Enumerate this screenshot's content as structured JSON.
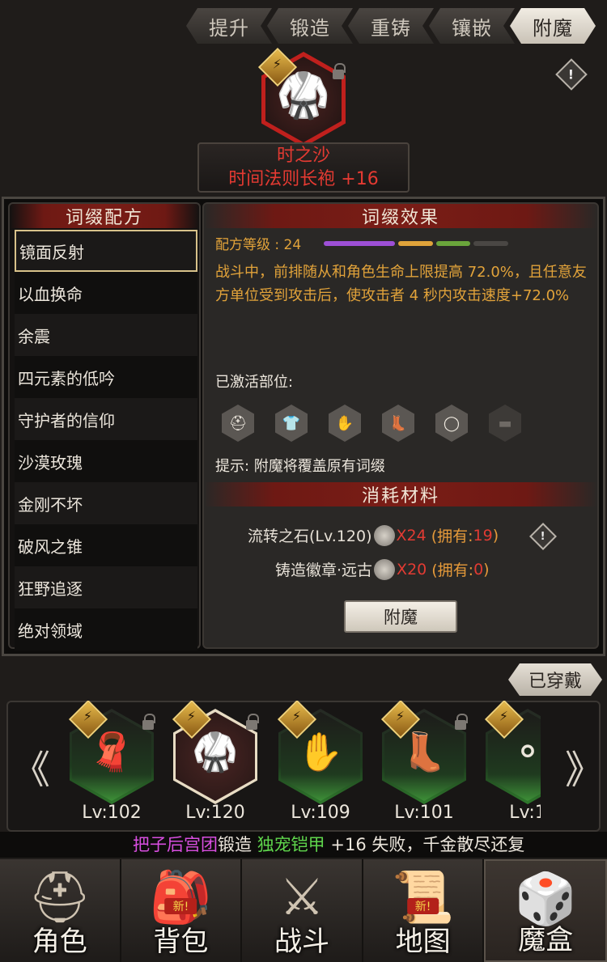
{
  "tabs": [
    {
      "label": "提升"
    },
    {
      "label": "锻造"
    },
    {
      "label": "重铸"
    },
    {
      "label": "镶嵌"
    },
    {
      "label": "附魔"
    }
  ],
  "help_icon": "!",
  "item": {
    "set_name": "时之沙",
    "name": "时间法则长袍 +16",
    "icon": "robe-icon"
  },
  "left_panel": {
    "title": "词缀配方",
    "recipes": [
      "镜面反射",
      "以血换命",
      "余震",
      "四元素的低吟",
      "守护者的信仰",
      "沙漠玫瑰",
      "金刚不坏",
      "破风之锥",
      "狂野追逐",
      "绝对领域"
    ]
  },
  "right_panel": {
    "title": "词缀效果",
    "grade_label": "配方等级 : 24",
    "grade_colors": [
      "#9d4fd6",
      "#e0a33a",
      "#6aa53b",
      "#4a4744"
    ],
    "effect_text": "战斗中，前排随从和角色生命上限提高 72.0%，且任意友方单位受到攻击后，使攻击者 4 秒内攻击速度+72.0%",
    "activated_label": "已激活部位:",
    "slots": [
      {
        "icon": "helmet-icon",
        "glyph": "⛑",
        "active": true
      },
      {
        "icon": "armor-icon",
        "glyph": "👕",
        "active": true
      },
      {
        "icon": "glove-icon",
        "glyph": "✋",
        "active": true
      },
      {
        "icon": "boots-icon",
        "glyph": "👢",
        "active": true
      },
      {
        "icon": "ring-icon",
        "glyph": "◯",
        "active": true
      },
      {
        "icon": "belt-icon",
        "glyph": "▬",
        "active": false
      }
    ],
    "hint": "提示: 附魔将覆盖原有词缀",
    "materials_title": "消耗材料",
    "materials": [
      {
        "name": "流转之石(Lv.120)",
        "qty": "X24",
        "owned_pre": "(拥有: ",
        "owned": "19",
        "owned_post": ")"
      },
      {
        "name": "铸造徽章·远古",
        "qty": "X20",
        "owned_pre": "(拥有: ",
        "owned": "0",
        "owned_post": ")"
      }
    ],
    "enchant_button": "附魔"
  },
  "equipped_label": "已穿戴",
  "carousel": {
    "prev": "《",
    "next": "》",
    "items": [
      {
        "icon": "scarf-icon",
        "glyph": "🧣",
        "level": "Lv:102"
      },
      {
        "icon": "robe-icon",
        "glyph": "🥋",
        "level": "Lv:120"
      },
      {
        "icon": "gauntlet-icon",
        "glyph": "✋",
        "level": "Lv:109"
      },
      {
        "icon": "greaves-icon",
        "glyph": "👢",
        "level": "Lv:101"
      },
      {
        "icon": "necklace-icon",
        "glyph": "⚬",
        "level": "Lv:1"
      }
    ]
  },
  "ticker": {
    "player": "把子后宫团",
    "action": "锻造 ",
    "item": "独宠铠甲",
    "rest": " +16 失败，千金散尽还复"
  },
  "nav": [
    {
      "label": "角色",
      "icon": "helmet-icon",
      "glyph": "⛑",
      "new": ""
    },
    {
      "label": "背包",
      "icon": "backpack-icon",
      "glyph": "🎒",
      "new": "新!"
    },
    {
      "label": "战斗",
      "icon": "sword-shield-icon",
      "glyph": "⚔",
      "new": ""
    },
    {
      "label": "地图",
      "icon": "scroll-icon",
      "glyph": "📜",
      "new": "新!"
    },
    {
      "label": "魔盒",
      "icon": "magic-box-icon",
      "glyph": "🎲",
      "new": ""
    }
  ]
}
